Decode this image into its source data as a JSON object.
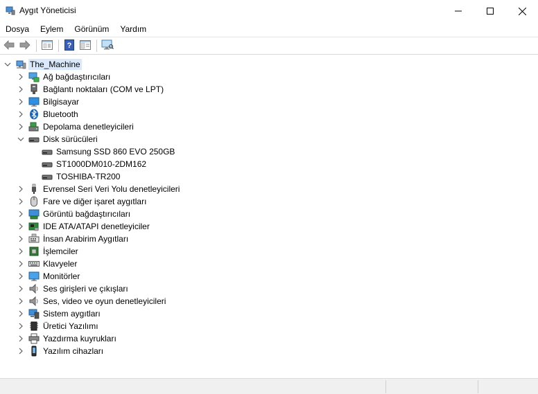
{
  "window": {
    "title": "Aygıt Yöneticisi",
    "controls": {
      "minimize": "minimize-icon",
      "maximize": "maximize-icon",
      "close": "close-icon"
    }
  },
  "menu": {
    "items": [
      {
        "label": "Dosya"
      },
      {
        "label": "Eylem"
      },
      {
        "label": "Görünüm"
      },
      {
        "label": "Yardım"
      }
    ]
  },
  "toolbar": {
    "buttons": [
      "back-arrow-icon",
      "forward-arrow-icon",
      "properties-icon",
      "help-icon",
      "view-icon",
      "monitor-scan-icon"
    ]
  },
  "tree": {
    "root": {
      "label": "The_Machine",
      "icon": "computer-root-icon"
    },
    "categories": [
      {
        "label": "Ağ bağdaştırıcıları",
        "icon": "network-icon",
        "expanded": false
      },
      {
        "label": "Bağlantı noktaları (COM ve LPT)",
        "icon": "port-icon",
        "expanded": false
      },
      {
        "label": "Bilgisayar",
        "icon": "computer-icon",
        "expanded": false
      },
      {
        "label": "Bluetooth",
        "icon": "bluetooth-icon",
        "expanded": false
      },
      {
        "label": "Depolama denetleyicileri",
        "icon": "storage-controller-icon",
        "expanded": false
      },
      {
        "label": "Disk sürücüleri",
        "icon": "disk-icon",
        "expanded": true,
        "children": [
          {
            "label": "Samsung SSD 860 EVO 250GB",
            "icon": "disk-icon"
          },
          {
            "label": "ST1000DM010-2DM162",
            "icon": "disk-icon"
          },
          {
            "label": "TOSHIBA-TR200",
            "icon": "disk-icon"
          }
        ]
      },
      {
        "label": "Evrensel Seri Veri Yolu denetleyicileri",
        "icon": "usb-icon",
        "expanded": false
      },
      {
        "label": "Fare ve diğer işaret aygıtları",
        "icon": "mouse-icon",
        "expanded": false
      },
      {
        "label": "Görüntü bağdaştırıcıları",
        "icon": "display-adapter-icon",
        "expanded": false
      },
      {
        "label": "IDE ATA/ATAPI denetleyiciler",
        "icon": "ide-icon",
        "expanded": false
      },
      {
        "label": "İnsan Arabirim Aygıtları",
        "icon": "hid-icon",
        "expanded": false
      },
      {
        "label": "İşlemciler",
        "icon": "processor-icon",
        "expanded": false
      },
      {
        "label": "Klavyeler",
        "icon": "keyboard-icon",
        "expanded": false
      },
      {
        "label": "Monitörler",
        "icon": "monitor-icon",
        "expanded": false
      },
      {
        "label": "Ses girişleri ve çıkışları",
        "icon": "speaker-icon",
        "expanded": false
      },
      {
        "label": "Ses, video ve oyun denetleyicileri",
        "icon": "speaker-icon",
        "expanded": false
      },
      {
        "label": "Sistem aygıtları",
        "icon": "system-device-icon",
        "expanded": false
      },
      {
        "label": "Üretici Yazılımı",
        "icon": "firmware-icon",
        "expanded": false
      },
      {
        "label": "Yazdırma kuyrukları",
        "icon": "printer-icon",
        "expanded": false
      },
      {
        "label": "Yazılım cihazları",
        "icon": "software-device-icon",
        "expanded": false
      }
    ]
  },
  "colors": {
    "selection": "#d9e8fb",
    "status_bar": "#f0f0f0",
    "chevron": "#5f5f5f"
  }
}
